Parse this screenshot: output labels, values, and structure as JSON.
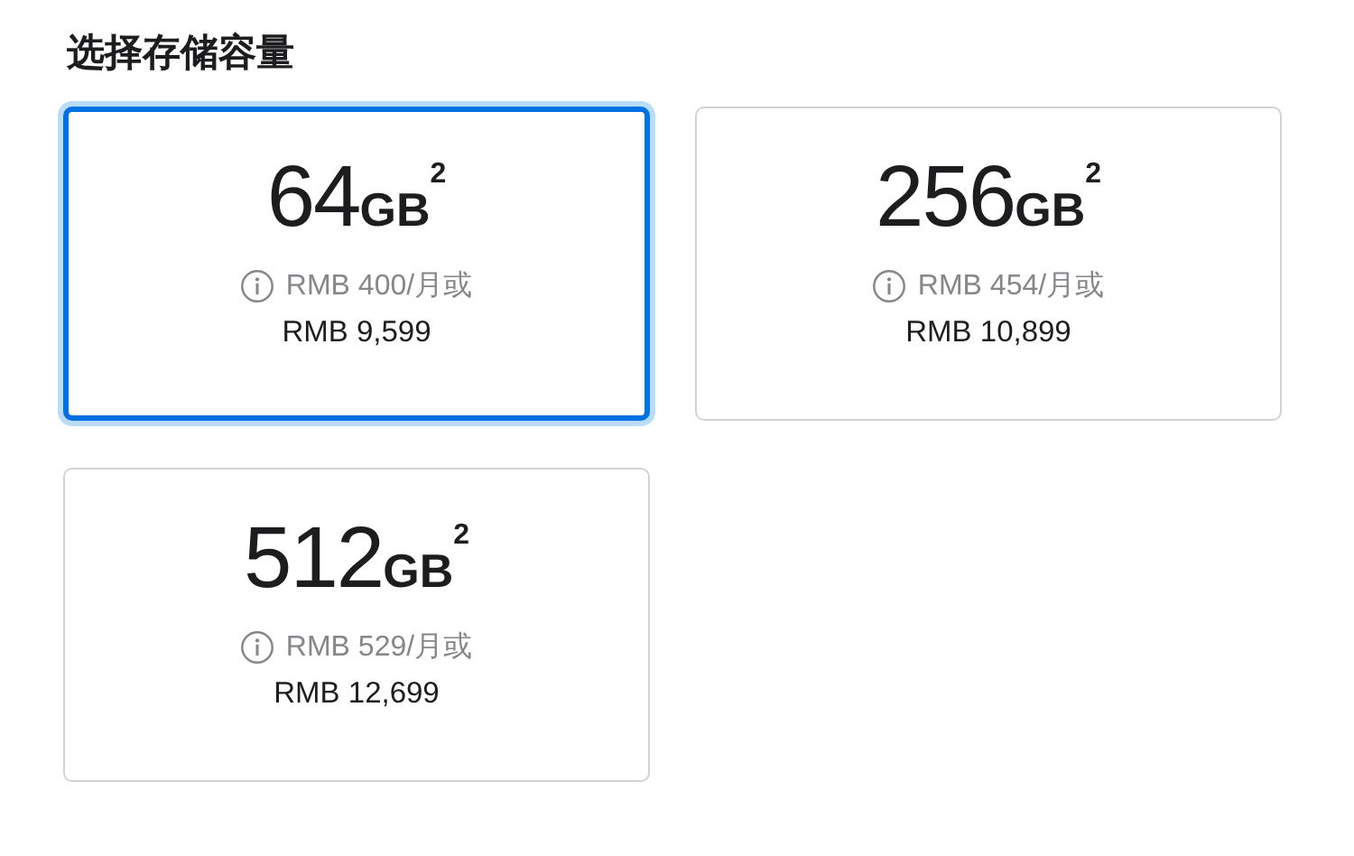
{
  "title": "选择存储容量",
  "options": [
    {
      "size": "64",
      "unit": "GB",
      "note": "2",
      "monthly": "RMB 400/月或",
      "price": "RMB 9,599",
      "selected": true
    },
    {
      "size": "256",
      "unit": "GB",
      "note": "2",
      "monthly": "RMB 454/月或",
      "price": "RMB 10,899",
      "selected": false
    },
    {
      "size": "512",
      "unit": "GB",
      "note": "2",
      "monthly": "RMB 529/月或",
      "price": "RMB 12,699",
      "selected": false
    }
  ]
}
